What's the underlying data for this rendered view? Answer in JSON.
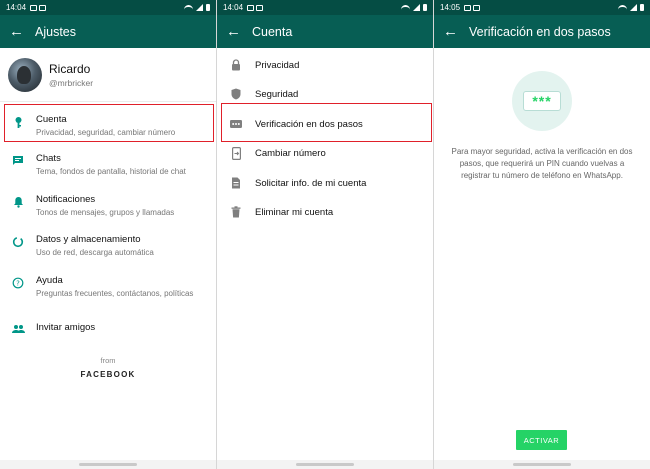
{
  "panel1": {
    "status_time": "14:04",
    "title": "Ajustes",
    "profile": {
      "name": "Ricardo",
      "handle": "@mrbricker"
    },
    "items": [
      {
        "title": "Cuenta",
        "subtitle": "Privacidad, seguridad, cambiar número"
      },
      {
        "title": "Chats",
        "subtitle": "Tema, fondos de pantalla, historial de chat"
      },
      {
        "title": "Notificaciones",
        "subtitle": "Tonos de mensajes, grupos y llamadas"
      },
      {
        "title": "Datos y almacenamiento",
        "subtitle": "Uso de red, descarga automática"
      },
      {
        "title": "Ayuda",
        "subtitle": "Preguntas frecuentes, contáctanos, políticas"
      },
      {
        "title": "Invitar amigos",
        "subtitle": ""
      }
    ],
    "from_label": "from",
    "brand": "FACEBOOK"
  },
  "panel2": {
    "status_time": "14:04",
    "title": "Cuenta",
    "items": [
      {
        "title": "Privacidad"
      },
      {
        "title": "Seguridad"
      },
      {
        "title": "Verificación en dos pasos"
      },
      {
        "title": "Cambiar número"
      },
      {
        "title": "Solicitar info. de mi cuenta"
      },
      {
        "title": "Eliminar mi cuenta"
      }
    ]
  },
  "panel3": {
    "status_time": "14:05",
    "title": "Verificación en dos pasos",
    "pin_glyph": "***",
    "description": "Para mayor seguridad, activa la verificación en dos pasos, que requerirá un PIN cuando vuelvas a registrar tu número de teléfono en WhatsApp.",
    "button": "ACTIVAR"
  },
  "colors": {
    "status_bar": "#054d44",
    "app_bar": "#075e54",
    "accent": "#009688",
    "primary_button": "#25d366",
    "highlight": "#e0202a"
  }
}
